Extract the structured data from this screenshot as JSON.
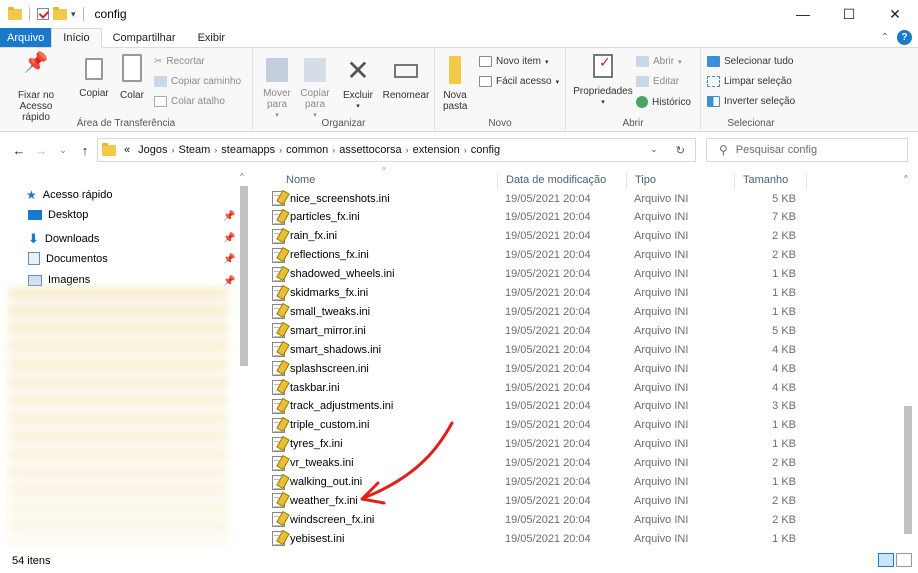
{
  "window": {
    "title": "config"
  },
  "ribbon_tabs": [
    "Arquivo",
    "Início",
    "Compartilhar",
    "Exibir"
  ],
  "ribbon": {
    "clipboard": {
      "label": "Área de Transferência",
      "pin": "Fixar no Acesso rápido",
      "copy": "Copiar",
      "paste": "Colar",
      "cut": "Recortar",
      "copy_path": "Copiar caminho",
      "paste_shortcut": "Colar atalho"
    },
    "organize": {
      "label": "Organizar",
      "move": "Mover para",
      "copy_to": "Copiar para",
      "delete": "Excluir",
      "rename": "Renomear"
    },
    "new": {
      "label": "Novo",
      "new_folder": "Nova pasta",
      "new_item": "Novo item",
      "easy_access": "Fácil acesso"
    },
    "open": {
      "label": "Abrir",
      "properties": "Propriedades",
      "open": "Abrir",
      "edit": "Editar",
      "history": "Histórico"
    },
    "select": {
      "label": "Selecionar",
      "select_all": "Selecionar tudo",
      "select_none": "Limpar seleção",
      "invert": "Inverter seleção"
    }
  },
  "address": {
    "crumbs": [
      "Jogos",
      "Steam",
      "steamapps",
      "common",
      "assettocorsa",
      "extension",
      "config"
    ],
    "overflow": "«"
  },
  "search": {
    "placeholder": "Pesquisar config"
  },
  "nav_pane": {
    "items": [
      {
        "label": "Acesso rápido",
        "icon": "star-icon"
      },
      {
        "label": "Desktop",
        "icon": "desktop-icon"
      },
      {
        "label": "Downloads",
        "icon": "download-icon"
      },
      {
        "label": "Documentos",
        "icon": "documents-icon"
      },
      {
        "label": "Imagens",
        "icon": "pictures-icon"
      }
    ]
  },
  "columns": {
    "name": "Nome",
    "date": "Data de modificação",
    "type": "Tipo",
    "size": "Tamanho"
  },
  "files": [
    {
      "name": "nice_screenshots.ini",
      "date": "19/05/2021 20:04",
      "type": "Arquivo INI",
      "size": "5 KB"
    },
    {
      "name": "particles_fx.ini",
      "date": "19/05/2021 20:04",
      "type": "Arquivo INI",
      "size": "7 KB"
    },
    {
      "name": "rain_fx.ini",
      "date": "19/05/2021 20:04",
      "type": "Arquivo INI",
      "size": "2 KB"
    },
    {
      "name": "reflections_fx.ini",
      "date": "19/05/2021 20:04",
      "type": "Arquivo INI",
      "size": "2 KB"
    },
    {
      "name": "shadowed_wheels.ini",
      "date": "19/05/2021 20:04",
      "type": "Arquivo INI",
      "size": "1 KB"
    },
    {
      "name": "skidmarks_fx.ini",
      "date": "19/05/2021 20:04",
      "type": "Arquivo INI",
      "size": "1 KB"
    },
    {
      "name": "small_tweaks.ini",
      "date": "19/05/2021 20:04",
      "type": "Arquivo INI",
      "size": "1 KB"
    },
    {
      "name": "smart_mirror.ini",
      "date": "19/05/2021 20:04",
      "type": "Arquivo INI",
      "size": "5 KB"
    },
    {
      "name": "smart_shadows.ini",
      "date": "19/05/2021 20:04",
      "type": "Arquivo INI",
      "size": "4 KB"
    },
    {
      "name": "splashscreen.ini",
      "date": "19/05/2021 20:04",
      "type": "Arquivo INI",
      "size": "4 KB"
    },
    {
      "name": "taskbar.ini",
      "date": "19/05/2021 20:04",
      "type": "Arquivo INI",
      "size": "4 KB"
    },
    {
      "name": "track_adjustments.ini",
      "date": "19/05/2021 20:04",
      "type": "Arquivo INI",
      "size": "3 KB"
    },
    {
      "name": "triple_custom.ini",
      "date": "19/05/2021 20:04",
      "type": "Arquivo INI",
      "size": "1 KB"
    },
    {
      "name": "tyres_fx.ini",
      "date": "19/05/2021 20:04",
      "type": "Arquivo INI",
      "size": "1 KB"
    },
    {
      "name": "vr_tweaks.ini",
      "date": "19/05/2021 20:04",
      "type": "Arquivo INI",
      "size": "2 KB"
    },
    {
      "name": "walking_out.ini",
      "date": "19/05/2021 20:04",
      "type": "Arquivo INI",
      "size": "1 KB"
    },
    {
      "name": "weather_fx.ini",
      "date": "19/05/2021 20:04",
      "type": "Arquivo INI",
      "size": "2 KB"
    },
    {
      "name": "windscreen_fx.ini",
      "date": "19/05/2021 20:04",
      "type": "Arquivo INI",
      "size": "2 KB"
    },
    {
      "name": "yebisest.ini",
      "date": "19/05/2021 20:04",
      "type": "Arquivo INI",
      "size": "1 KB"
    }
  ],
  "status": {
    "count": "54 itens"
  },
  "colors": {
    "accent": "#1979ca",
    "annotation_arrow": "#e0201c"
  }
}
